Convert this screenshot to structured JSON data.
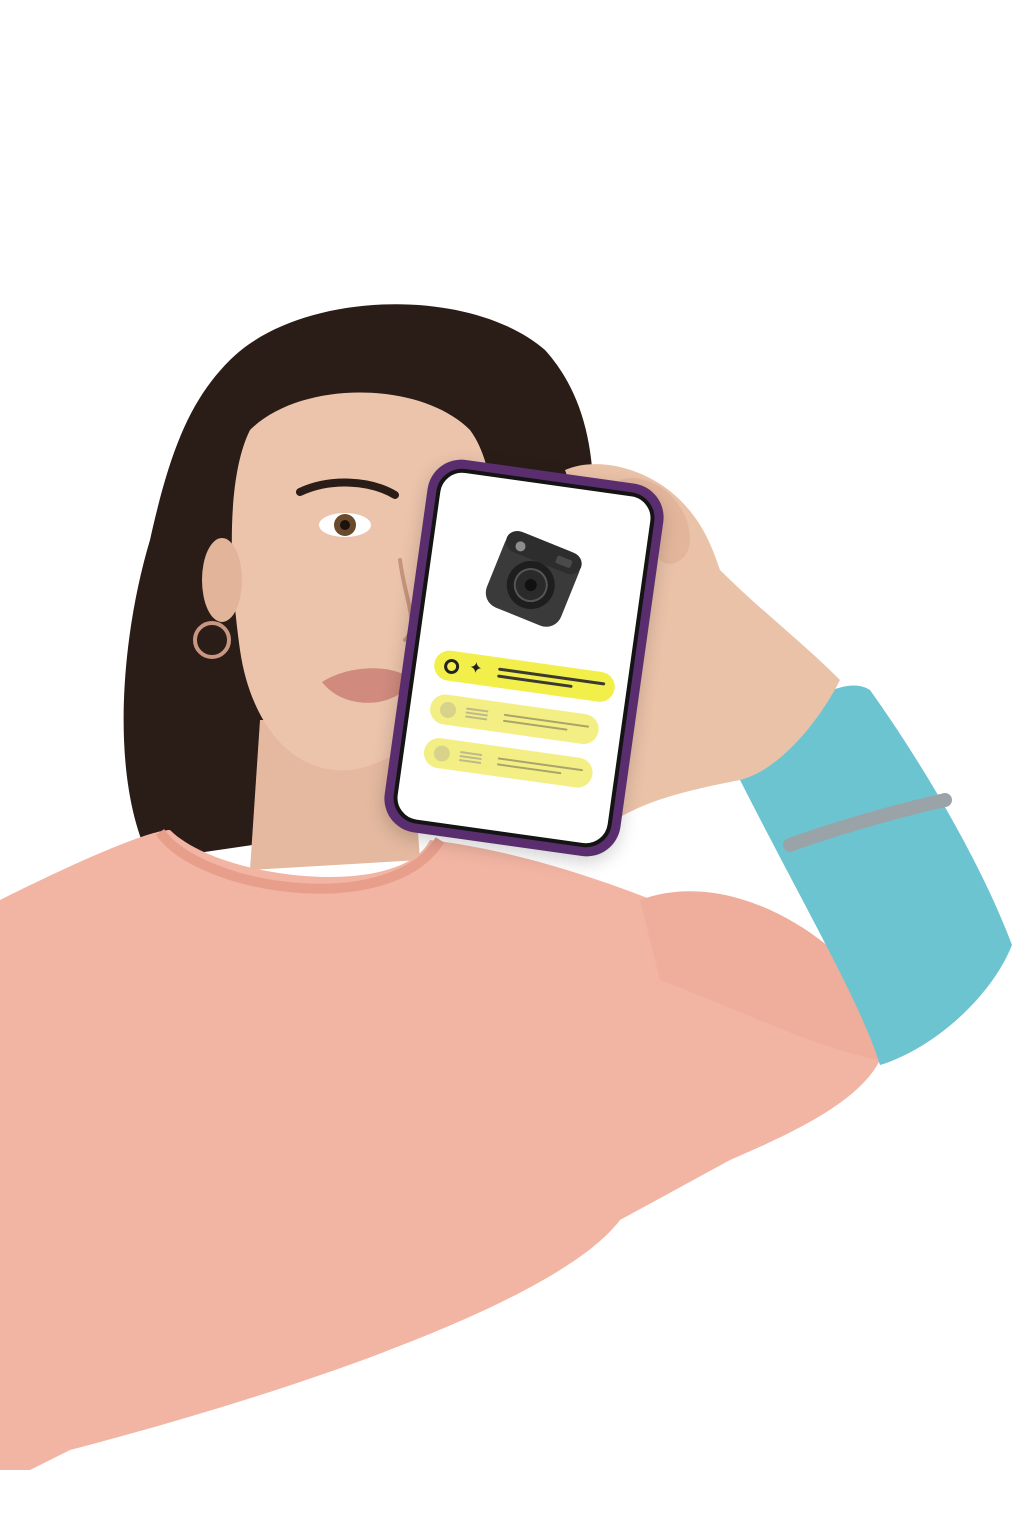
{
  "scene": {
    "description_type": "photo",
    "colors": {
      "background": "#ffffff",
      "sweater": "#f2b5a3",
      "sleeve": "#6cc4d0",
      "skin": "#e8c0a8",
      "hair": "#2a1d17",
      "phone_case": "#5a2e6e",
      "pill_primary": "#f3ef4a",
      "pill_secondary": "#f4ef84"
    }
  },
  "phone_screen": {
    "app_icon": "instant-camera-icon",
    "rows": [
      {
        "icon": "ring-icon",
        "secondary_icon": "sparkle-icon",
        "style": "primary"
      },
      {
        "icon": "dot-icon",
        "style": "secondary"
      },
      {
        "icon": "dot-icon",
        "style": "secondary"
      }
    ]
  }
}
